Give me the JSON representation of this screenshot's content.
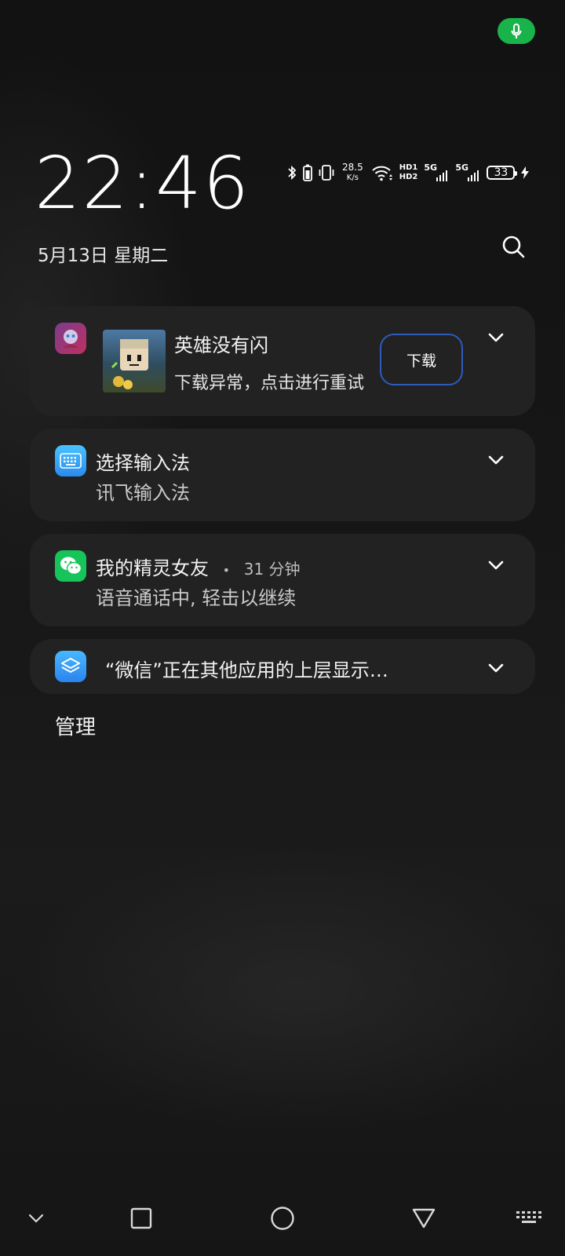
{
  "status_bar": {
    "mic_icon": "microphone-icon",
    "mic_color": "#19b24b",
    "net_speed_value": "28.5",
    "net_speed_unit": "K/s",
    "hd1": "HD1",
    "hd2": "HD2",
    "sim1_label": "5G",
    "sim2_label": "5G",
    "battery_level": "33"
  },
  "lockscreen": {
    "time": "22:46",
    "date": "5月13日 星期二"
  },
  "notifications": [
    {
      "app_icon": "game-app-icon",
      "title": "英雄没有闪",
      "text": "下载异常，点击进行重试",
      "action_label": "下载"
    },
    {
      "app_icon": "keyboard-icon",
      "title": "选择输入法",
      "text": "讯飞输入法"
    },
    {
      "app_icon": "wechat-icon",
      "title": "我的精灵女友",
      "separator": "•",
      "time_ago": "31 分钟",
      "text": "语音通话中, 轻击以继续"
    },
    {
      "app_icon": "layers-icon",
      "title": "“微信”正在其他应用的上层显示…"
    }
  ],
  "manage_label": "管理",
  "navbar": {
    "items": [
      "collapse-chevron-icon",
      "recents-square-icon",
      "home-circle-icon",
      "back-triangle-icon",
      "keyboard-toggle-icon"
    ]
  },
  "colors": {
    "accent_button_border": "#2f5bbb",
    "card_bg": "#222222"
  }
}
